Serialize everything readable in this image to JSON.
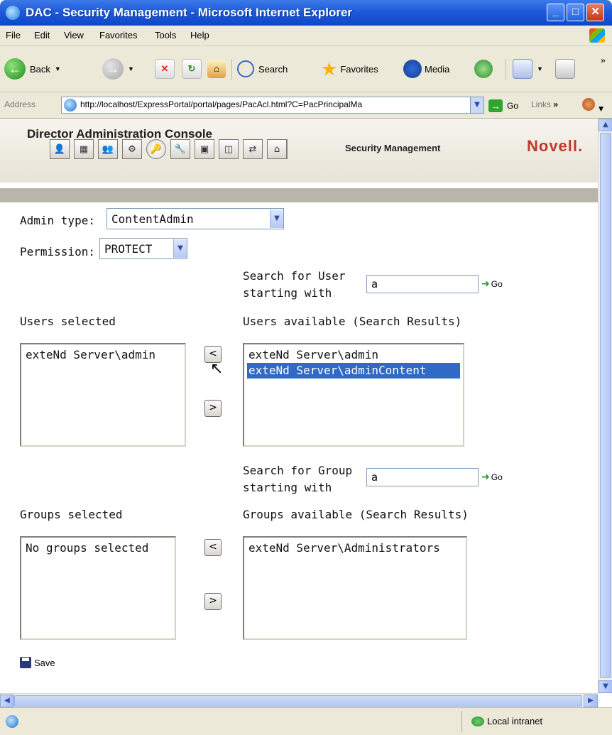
{
  "window": {
    "title": "DAC - Security Management - Microsoft Internet Explorer",
    "min": "_",
    "max": "□",
    "close": "✕"
  },
  "menu": [
    "File",
    "Edit",
    "View",
    "Favorites",
    "Tools",
    "Help"
  ],
  "toolbar": {
    "back": "Back",
    "search": "Search",
    "favorites": "Favorites",
    "media": "Media"
  },
  "address": {
    "label": "Address",
    "url": "http://localhost/ExpressPortal/portal/pages/PacAcl.html?C=PacPrincipalMa",
    "go": "Go",
    "links": "Links"
  },
  "banner": {
    "title": "Director Administration Console",
    "section": "Security Management",
    "logo": "Novell."
  },
  "form": {
    "admin_type_label": "Admin type:",
    "admin_type_value": "ContentAdmin",
    "permission_label": "Permission:",
    "permission_value": "PROTECT",
    "user_search_label_1": "Search for User",
    "user_search_label_2": "starting with",
    "user_search_value": "a",
    "user_go": "Go",
    "users_selected_label": "Users selected",
    "users_available_label": "Users available (Search Results)",
    "users_selected": [
      "exteNd Server\\admin"
    ],
    "users_available": [
      "exteNd Server\\admin",
      "exteNd Server\\adminContent"
    ],
    "move_left": "<",
    "move_right": ">",
    "group_search_label_1": "Search for Group",
    "group_search_label_2": "starting with",
    "group_search_value": "a",
    "group_go": "Go",
    "groups_selected_label": "Groups selected",
    "groups_available_label": "Groups available (Search Results)",
    "groups_selected": [
      "No groups selected"
    ],
    "groups_available": [
      "exteNd Server\\Administrators"
    ],
    "save": "Save"
  },
  "status": {
    "zone": "Local intranet"
  }
}
